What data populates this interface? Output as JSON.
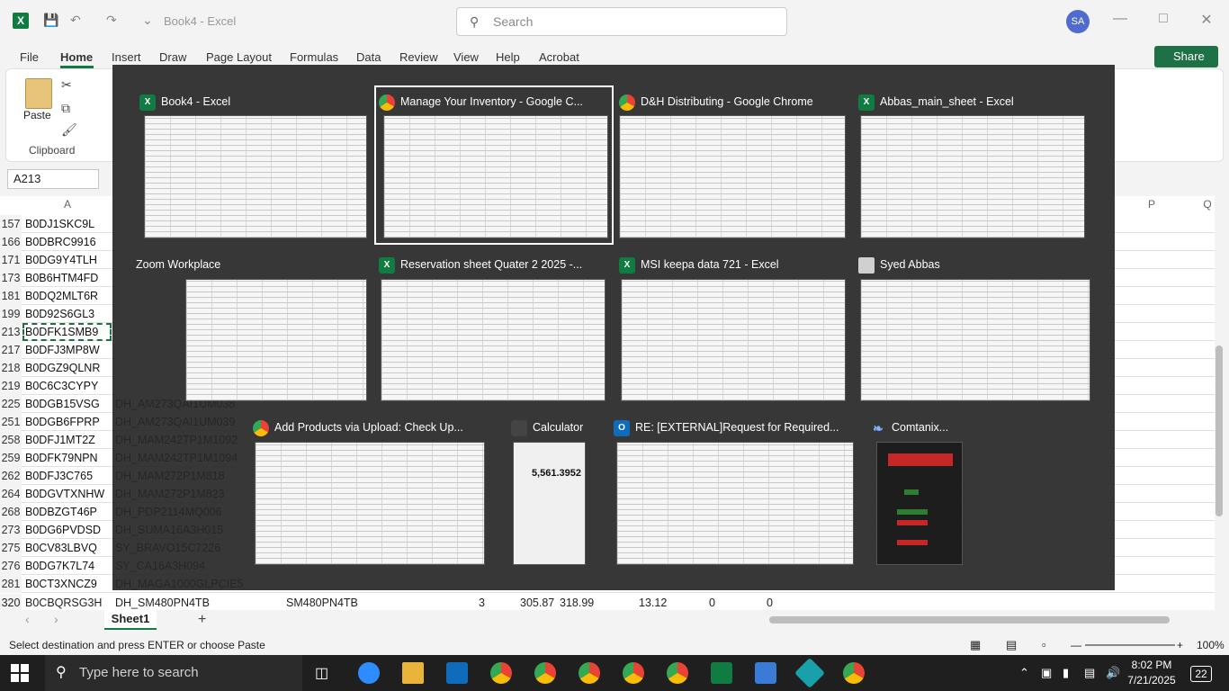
{
  "titlebar": {
    "app_icon": "excel-icon",
    "doc_title": "Book4 - Excel",
    "search_placeholder": "Search",
    "user_initials": "SA"
  },
  "menu": [
    "File",
    "Home",
    "Insert",
    "Draw",
    "Page Layout",
    "Formulas",
    "Data",
    "Review",
    "View",
    "Help",
    "Acrobat"
  ],
  "active_menu": "Home",
  "share_label": "Share",
  "ribbon": {
    "paste_label": "Paste",
    "clipboard_label": "Clipboard"
  },
  "name_box": "A213",
  "rows": [
    {
      "n": "157",
      "a": "B0DJ1SKC9L"
    },
    {
      "n": "166",
      "a": "B0DBRC9916"
    },
    {
      "n": "171",
      "a": "B0DG9Y4TLH"
    },
    {
      "n": "173",
      "a": "B0B6HTM4FD"
    },
    {
      "n": "181",
      "a": "B0DQ2MLT6R"
    },
    {
      "n": "199",
      "a": "B0D92S6GL3"
    },
    {
      "n": "213",
      "a": "B0DFK1SMB9"
    },
    {
      "n": "217",
      "a": "B0DFJ3MP8W"
    },
    {
      "n": "218",
      "a": "B0DGZ9QLNR"
    },
    {
      "n": "219",
      "a": "B0C6C3CYPY"
    },
    {
      "n": "225",
      "a": "B0DGB15VSG",
      "b": "DH_AM273QAI1UM038"
    },
    {
      "n": "251",
      "a": "B0DGB6FPRP",
      "b": "DH_AM273QAI1UM039"
    },
    {
      "n": "258",
      "a": "B0DFJ1MT2Z",
      "b": "DH_MAM242TP1M1092"
    },
    {
      "n": "259",
      "a": "B0DFK79NPN",
      "b": "DH_MAM242TP1M1094"
    },
    {
      "n": "262",
      "a": "B0DFJ3C765",
      "b": "DH_MAM272P1M818"
    },
    {
      "n": "264",
      "a": "B0DGVTXNHW",
      "b": "DH_MAM272P1M823"
    },
    {
      "n": "268",
      "a": "B0DBZGT46P",
      "b": "DH_PDP2114MQ006"
    },
    {
      "n": "273",
      "a": "B0DG6PVDSD",
      "b": "DH_SUMA16A3H015"
    },
    {
      "n": "275",
      "a": "B0CV83LBVQ",
      "b": "SY_BRAVO15C7226"
    },
    {
      "n": "276",
      "a": "B0DG7K7L74",
      "b": "SY_CA16A3H094"
    },
    {
      "n": "281",
      "a": "B0CT3XNCZ9",
      "b": "DH_MAGA1000GLPCIE5"
    }
  ],
  "bottom_row": {
    "n": "320",
    "a": "B0CBQRSG3H",
    "b": "DH_SM480PN4TB",
    "c": "SM480PN4TB",
    "d": "3",
    "e": "305.87",
    "f": "318.99",
    "g": "13.12",
    "h": "0",
    "i": "0"
  },
  "sheet_tab": "Sheet1",
  "status_text": "Select destination and press ENTER or choose Paste",
  "zoom": "100%",
  "alt_tab": [
    {
      "title": "Book4 - Excel",
      "icon": "excel-icon"
    },
    {
      "title": "Manage Your Inventory - Google C...",
      "icon": "chrome-icon"
    },
    {
      "title": "D&H Distributing - Google Chrome",
      "icon": "chrome-icon"
    },
    {
      "title": "Abbas_main_sheet - Excel",
      "icon": "excel-icon"
    },
    {
      "title": "Zoom Workplace",
      "icon": "zoom-icon"
    },
    {
      "title": "Reservation sheet Quater 2 2025 -...",
      "icon": "excel-icon"
    },
    {
      "title": "MSI keepa data 721 - Excel",
      "icon": "excel-icon"
    },
    {
      "title": "Syed Abbas",
      "icon": "file-explorer-icon"
    },
    {
      "title": "Add Products via Upload: Check Up...",
      "icon": "chrome-icon"
    },
    {
      "title": "Calculator",
      "icon": "calculator-icon"
    },
    {
      "title": "RE: [EXTERNAL]Request for Required...",
      "icon": "outlook-icon"
    },
    {
      "title": "Comtanix...",
      "icon": "feather-icon"
    }
  ],
  "calculator_display": "5,561.3952",
  "taskbar": {
    "search_placeholder": "Type here to search",
    "time": "8:02 PM",
    "date": "7/21/2025",
    "notifications": "22"
  }
}
